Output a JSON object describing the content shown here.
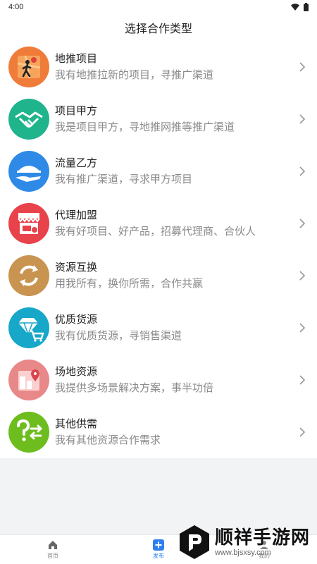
{
  "status_bar": {
    "time": "4:00"
  },
  "header": {
    "title": "选择合作类型"
  },
  "items": [
    {
      "title": "地推项目",
      "desc": "我有地推拉新的项目，寻推广渠道",
      "icon": "map-walker-icon",
      "color": "#f07c3a"
    },
    {
      "title": "项目甲方",
      "desc": "我是项目甲方，寻地推网推等推广渠道",
      "icon": "handshake-icon",
      "color": "#1fb48c"
    },
    {
      "title": "流量乙方",
      "desc": "我有推广渠道，寻求甲方项目",
      "icon": "tray-hand-icon",
      "color": "#2e8ae6"
    },
    {
      "title": "代理加盟",
      "desc": "我有好项目、好产品，招募代理商、合伙人",
      "icon": "storefront-icon",
      "color": "#e8424a"
    },
    {
      "title": "资源互换",
      "desc": "用我所有，换你所需，合作共赢",
      "icon": "swap-arrows-icon",
      "color": "#c99350"
    },
    {
      "title": "优质货源",
      "desc": "我有优质货源，寻销售渠道",
      "icon": "diamond-cart-icon",
      "color": "#16a7c9"
    },
    {
      "title": "场地资源",
      "desc": "我提供多场景解决方案，事半功倍",
      "icon": "venue-map-icon",
      "color": "#e88888"
    },
    {
      "title": "其他供需",
      "desc": "我有其他资源合作需求",
      "icon": "question-exchange-icon",
      "color": "#6dbd1e"
    }
  ],
  "bottom_nav": {
    "home": "首页",
    "publish": "发布",
    "mine": "我的"
  },
  "watermark": {
    "title": "顺祥手游网",
    "url": "www.bjsxsy.com"
  }
}
